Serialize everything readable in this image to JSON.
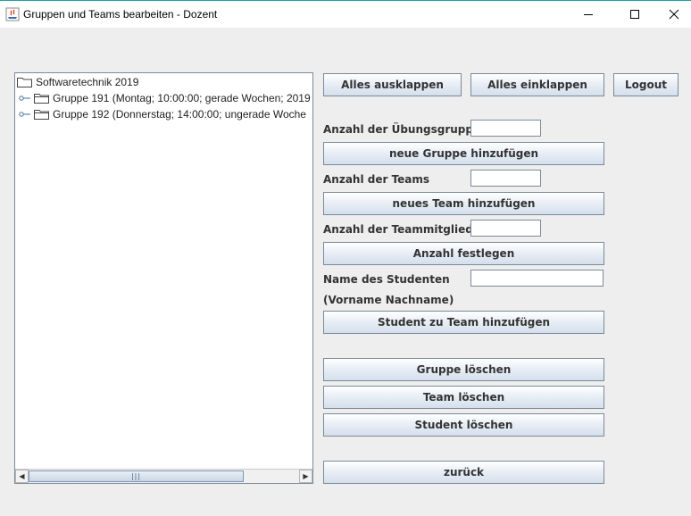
{
  "window": {
    "title": "Gruppen und Teams bearbeiten - Dozent"
  },
  "tree": {
    "root": "Softwaretechnik 2019",
    "children": [
      "Gruppe 191  (Montag; 10:00:00; gerade Wochen; 2019",
      "Gruppe 192  (Donnerstag; 14:00:00; ungerade Woche"
    ]
  },
  "toolbar": {
    "expand_all": "Alles ausklappen",
    "collapse_all": "Alles einklappen",
    "logout": "Logout"
  },
  "form": {
    "groups_count_label": "Anzahl der Übungsgruppen",
    "groups_count_value": "",
    "add_group": "neue Gruppe hinzufügen",
    "teams_count_label": "Anzahl der Teams",
    "teams_count_value": "",
    "add_team": "neues Team hinzufügen",
    "members_count_label": "Anzahl der Teammitglieder",
    "members_count_value": "",
    "set_count": "Anzahl festlegen",
    "student_name_label": "Name des Studenten",
    "student_name_hint": "(Vorname Nachname)",
    "student_name_value": "",
    "add_student_to_team": "Student zu Team hinzufügen",
    "delete_group": "Gruppe löschen",
    "delete_team": "Team löschen",
    "delete_student": "Student löschen",
    "back": "zurück"
  },
  "colors": {
    "window_bg": "#eeeeee",
    "button_border": "#7a8a99",
    "title_accent": "#1e9fa0"
  }
}
